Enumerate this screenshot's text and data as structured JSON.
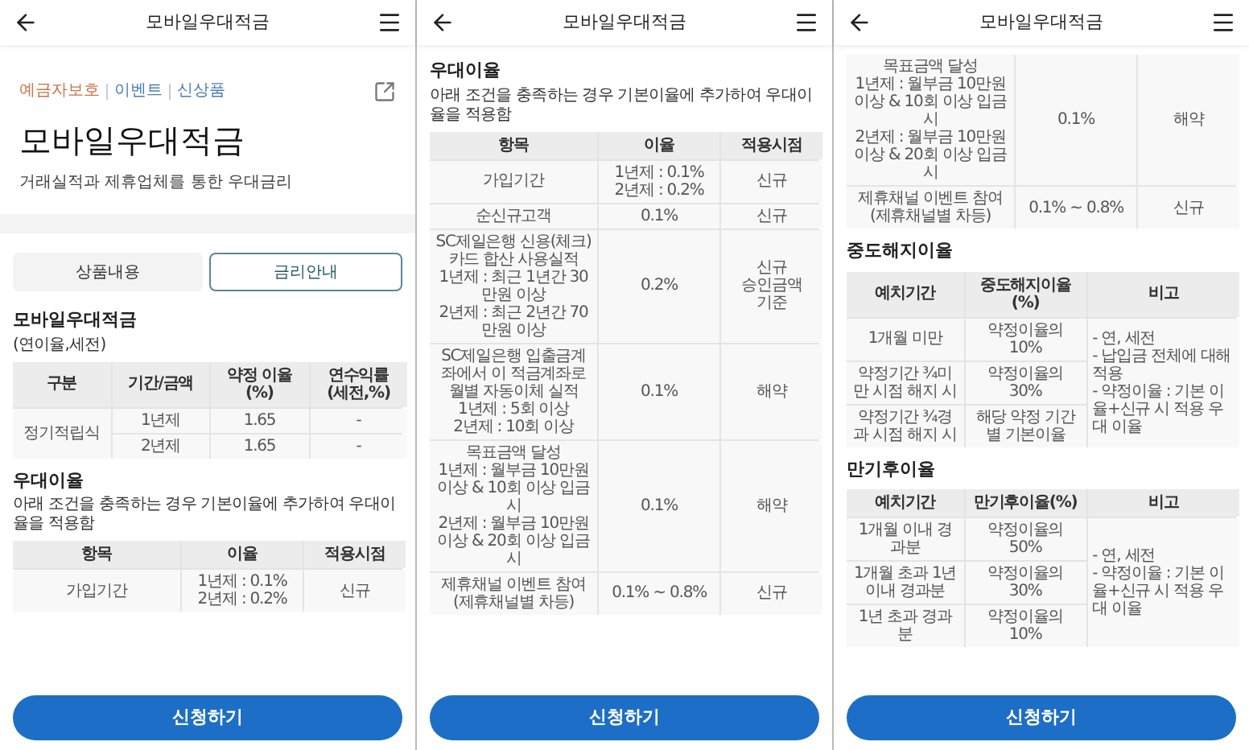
{
  "screens": [
    {
      "header": {
        "title": "모바일우대적금"
      },
      "blocks": [
        {
          "kind": "product",
          "tags": [
            {
              "label": "예금자보호",
              "color": "#c8744a"
            },
            {
              "label": "이벤트",
              "color": "#4a7fb5"
            },
            {
              "label": "신상품",
              "color": "#4a7fb5"
            }
          ],
          "title": "모바일우대적금",
          "subtitle": "거래실적과 제휴업체를 통한 우대금리"
        },
        {
          "kind": "tabs",
          "tabs": [
            {
              "label": "상품내용",
              "selected": false
            },
            {
              "label": "금리안내",
              "selected": true
            }
          ]
        },
        {
          "kind": "heading",
          "text": "모바일우대적금"
        },
        {
          "kind": "text",
          "text": "(연이율,세전)"
        },
        {
          "kind": "grouped_table",
          "columns": [
            "구분",
            "기간/금액",
            "약정 이율\n(%)",
            "연수익률\n(세전,%)"
          ],
          "groups": [
            {
              "label": "정기적립식",
              "rows": [
                [
                  "1년제",
                  "1.65",
                  "-"
                ],
                [
                  "2년제",
                  "1.65",
                  "-"
                ]
              ]
            }
          ]
        },
        {
          "kind": "heading",
          "text": "우대이율"
        },
        {
          "kind": "text",
          "text": "아래 조건을 충족하는 경우 기본이율에 추가하여 우대이율을 적용함"
        },
        {
          "kind": "table",
          "columns": [
            "항목",
            "이율",
            "적용시점"
          ],
          "rows": [
            [
              "가입기간",
              "1년제 : 0.1%\n2년제 : 0.2%",
              "신규"
            ]
          ]
        }
      ],
      "button": "신청하기"
    },
    {
      "header": {
        "title": "모바일우대적금"
      },
      "blocks": [
        {
          "kind": "heading",
          "text": "우대이율"
        },
        {
          "kind": "text",
          "text": "아래 조건을 충족하는 경우 기본이율에 추가하여 우대이율을 적용함"
        },
        {
          "kind": "table",
          "columns": [
            "항목",
            "이율",
            "적용시점"
          ],
          "rows": [
            [
              "가입기간",
              "1년제 : 0.1%\n2년제 : 0.2%",
              "신규"
            ],
            [
              "순신규고객",
              "0.1%",
              "신규"
            ],
            [
              "SC제일은행 신용(체크)카드 합산 사용실적\n1년제 : 최근 1년간 30만원 이상\n2년제 : 최근 2년간 70만원 이상",
              "0.2%",
              "신규\n승인금액\n기준"
            ],
            [
              "SC제일은행 입출금계좌에서 이 적금계좌로 월별 자동이체 실적\n1년제 : 5회 이상\n2년제 : 10회 이상",
              "0.1%",
              "해약"
            ],
            [
              "목표금액 달성\n1년제 : 월부금 10만원 이상 & 10회 이상 입금 시\n2년제 : 월부금 10만원 이상 & 20회 이상 입금 시",
              "0.1%",
              "해약"
            ],
            [
              "제휴채널 이벤트 참여\n(제휴채널별 차등)",
              "0.1% ~ 0.8%",
              "신규"
            ]
          ]
        }
      ],
      "button": "신청하기"
    },
    {
      "header": {
        "title": "모바일우대적금"
      },
      "blocks": [
        {
          "kind": "table",
          "rows": [
            [
              "목표금액 달성\n1년제 : 월부금 10만원 이상 & 10회 이상 입금 시\n2년제 : 월부금 10만원 이상 & 20회 이상 입금 시",
              "0.1%",
              "해약"
            ],
            [
              "제휴채널 이벤트 참여\n(제휴채널별 차등)",
              "0.1% ~ 0.8%",
              "신규"
            ]
          ]
        },
        {
          "kind": "heading",
          "text": "중도해지이율"
        },
        {
          "kind": "noted_table",
          "columns": [
            "예치기간",
            "중도해지이율(%)",
            "비고"
          ],
          "rows": [
            [
              "1개월 미만",
              "약정이율의 10%"
            ],
            [
              "약정기간 ¾미만 시점 해지 시",
              "약정이율의 30%"
            ],
            [
              "약정기간 ¾경과 시점 해지 시",
              "해당 약정 기간별 기본이율"
            ]
          ],
          "note": "- 연, 세전\n- 납입금 전체에 대해 적용\n- 약정이율 : 기본 이율+신규 시 적용 우대 이율"
        },
        {
          "kind": "heading",
          "text": "만기후이율"
        },
        {
          "kind": "noted_table",
          "columns": [
            "예치기간",
            "만기후이율(%)",
            "비고"
          ],
          "rows": [
            [
              "1개월 이내 경과분",
              "약정이율의 50%"
            ],
            [
              "1개월 초과 1년 이내 경과분",
              "약정이율의 30%"
            ],
            [
              "1년 초과 경과분",
              "약정이율의 10%"
            ]
          ],
          "note": "- 연, 세전\n- 약정이율 : 기본 이율+신규 시 적용 우대 이율"
        }
      ],
      "button": "신청하기"
    }
  ]
}
